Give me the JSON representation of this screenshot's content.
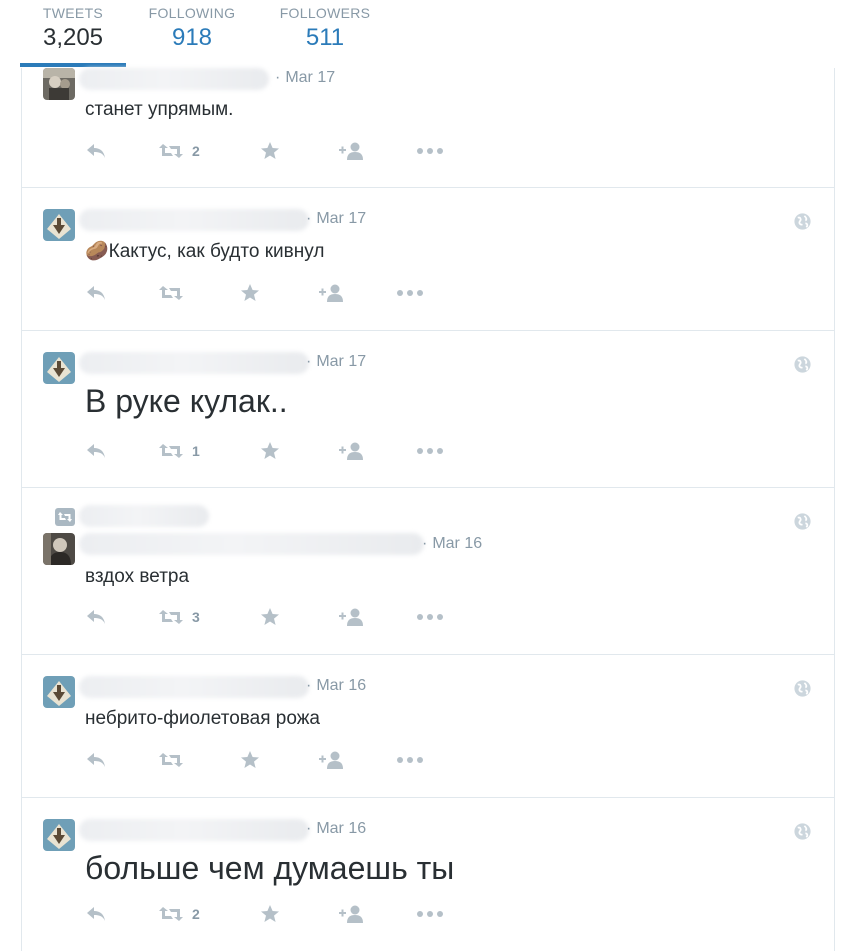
{
  "stats": {
    "tweets": {
      "label": "TWEETS",
      "value": "3,205",
      "active": true
    },
    "following": {
      "label": "FOLLOWING",
      "value": "918"
    },
    "followers": {
      "label": "FOLLOWERS",
      "value": "511"
    }
  },
  "colors": {
    "accent": "#2b7bb9",
    "muted": "#8899a6",
    "text": "#292f33",
    "border": "#e1e8ed"
  },
  "icons": {
    "reply": "reply-icon",
    "retweet": "retweet-icon",
    "favorite": "star-icon",
    "follow": "follow-icon",
    "more": "more-icon",
    "globe": "globe-icon",
    "retweeted": "retweeted-badge-icon"
  },
  "tweets": [
    {
      "author": "",
      "date": "Mar 17",
      "text": "станет упрямым.",
      "retweets": "2",
      "avatar": "photo",
      "clipped": true
    },
    {
      "author": "",
      "date": "Mar 17",
      "text": "🥔Кактус, как будто кивнул",
      "retweets": "",
      "avatar": "logo"
    },
    {
      "author": "",
      "date": "Mar 17",
      "text": "В руке кулак..",
      "retweets": "1",
      "avatar": "logo"
    },
    {
      "author": "",
      "date": "Mar 16",
      "text": "вздох ветра",
      "retweets": "3",
      "avatar": "photo",
      "retweeted": true
    },
    {
      "author": "",
      "date": "Mar 16",
      "text": "небрито-фиолетовая рожа",
      "retweets": "",
      "avatar": "logo"
    },
    {
      "author": "",
      "date": "Mar 16",
      "text": "больше чем думаешь ты",
      "retweets": "2",
      "avatar": "logo"
    }
  ]
}
